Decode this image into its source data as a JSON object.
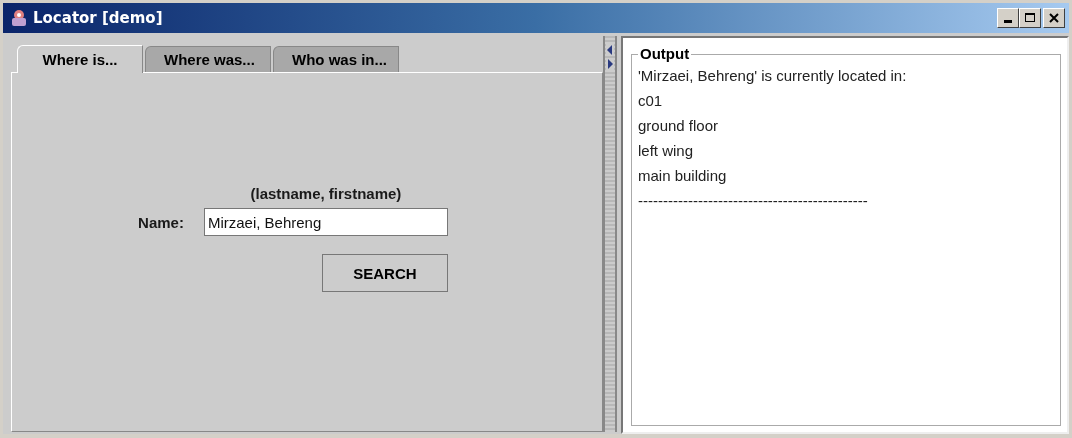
{
  "window": {
    "title": "Locator [demo]"
  },
  "tabs": [
    {
      "label": "Where is...",
      "selected": true
    },
    {
      "label": "Where was...",
      "selected": false
    },
    {
      "label": "Who was in...",
      "selected": false
    }
  ],
  "form": {
    "hint": "(lastname, firstname)",
    "name_label": "Name:",
    "name_value": "Mirzaei, Behreng",
    "button": "SEARCH"
  },
  "output": {
    "title": "Output",
    "lines": [
      "'Mirzaei, Behreng' is currently located in:",
      "c01",
      "ground floor",
      "left wing",
      "main building",
      "----------------------------------------------"
    ]
  }
}
